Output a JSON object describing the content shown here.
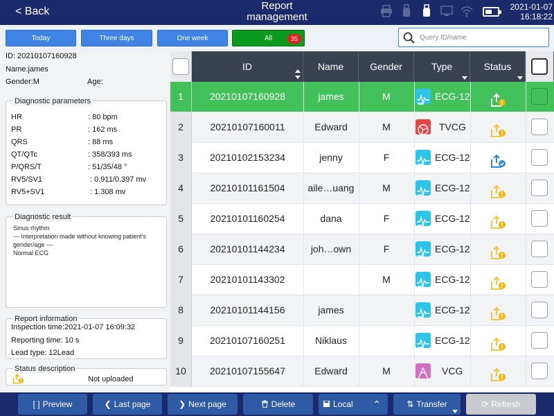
{
  "header": {
    "back_label": "< Back",
    "title_line1": "Report",
    "title_line2": "management",
    "date": "2021-01-07",
    "time": "16:18:22",
    "battery_level": 0.55,
    "icons": [
      "printer-icon",
      "usb-device-icon",
      "usb-icon",
      "monitor-icon",
      "wifi-icon",
      "battery-icon"
    ]
  },
  "filters": [
    {
      "label": "Today"
    },
    {
      "label": "Three days"
    },
    {
      "label": "One week"
    },
    {
      "label": "All",
      "count": "35",
      "active": true
    }
  ],
  "search": {
    "placeholder": "Query ID/name"
  },
  "patient": {
    "id_line": "ID: 20210107160928",
    "name_line": "Name:james",
    "gender_line": "Gender:M",
    "age_line": "Age:"
  },
  "diagnostic_parameters": {
    "title": "Diagnostic parameters",
    "items": [
      {
        "key": "HR",
        "value": ": 80 bpm"
      },
      {
        "key": "PR",
        "value": ": 162 ms"
      },
      {
        "key": "QRS",
        "value": ": 88 ms"
      },
      {
        "key": "QT/QTc",
        "value": ": 358/393 ms"
      },
      {
        "key": "P/QRS/T",
        "value": ": 51/35/48 °"
      },
      {
        "key": "RV5/SV1",
        "value": ": 0.911/0.397 mv"
      },
      {
        "key": "RV5+SV1",
        "value": ": 1.308 mv"
      }
    ]
  },
  "diagnostic_result": {
    "title": "Diagnostic result",
    "lines": [
      "Sinus rhythm",
      "--- Interpretation made without knowing patient's",
      "gender/age ---",
      "Normal ECG"
    ]
  },
  "report_information": {
    "title": "Report information",
    "inspection_time": "Inspection time:2021-01-07 16:09:32",
    "reporting_time": "Reporting time: 10 s",
    "lead_type": "Lead type: 12Lead"
  },
  "status_description": {
    "title": "Status description",
    "text": "Not uploaded"
  },
  "table": {
    "columns": {
      "id": "ID",
      "name": "Name",
      "gender": "Gender",
      "type": "Type",
      "status": "Status"
    },
    "colors": {
      "ECG-12": "#2ec4e8",
      "TVCG": "#e04848",
      "VCG": "#d070c0"
    },
    "rows": [
      {
        "num": "1",
        "id": "20210107160928",
        "name": "james",
        "gender": "M",
        "type": "ECG-12",
        "status": "not-uploaded",
        "selected": true
      },
      {
        "num": "2",
        "id": "20210107160011",
        "name": "Edward",
        "gender": "M",
        "type": "TVCG",
        "status": "not-uploaded"
      },
      {
        "num": "3",
        "id": "20210102153234",
        "name": "jenny",
        "gender": "F",
        "type": "ECG-12",
        "status": "uploaded"
      },
      {
        "num": "4",
        "id": "20210101161504",
        "name": "aile…uang",
        "gender": "M",
        "type": "ECG-12",
        "status": "not-uploaded"
      },
      {
        "num": "5",
        "id": "20210101160254",
        "name": "dana",
        "gender": "F",
        "type": "ECG-12",
        "status": "not-uploaded"
      },
      {
        "num": "6",
        "id": "20210101144234",
        "name": "joh…own",
        "gender": "F",
        "type": "ECG-12",
        "status": "not-uploaded"
      },
      {
        "num": "7",
        "id": "20210101143302",
        "name": "",
        "gender": "M",
        "type": "ECG-12",
        "status": "not-uploaded"
      },
      {
        "num": "8",
        "id": "20210101144156",
        "name": "james",
        "gender": "",
        "type": "ECG-12",
        "status": "not-uploaded"
      },
      {
        "num": "9",
        "id": "20210107160251",
        "name": "Niklaus",
        "gender": "",
        "type": "ECG-12",
        "status": "not-uploaded"
      },
      {
        "num": "10",
        "id": "20210107155647",
        "name": "Edward",
        "gender": "M",
        "type": "VCG",
        "status": "not-uploaded"
      }
    ]
  },
  "toolbar": {
    "preview": "Preview",
    "last_page": "Last page",
    "next_page": "Next page",
    "delete": "Delete",
    "local": "Local",
    "transfer": "Transfer",
    "refresh": "Refresh"
  }
}
